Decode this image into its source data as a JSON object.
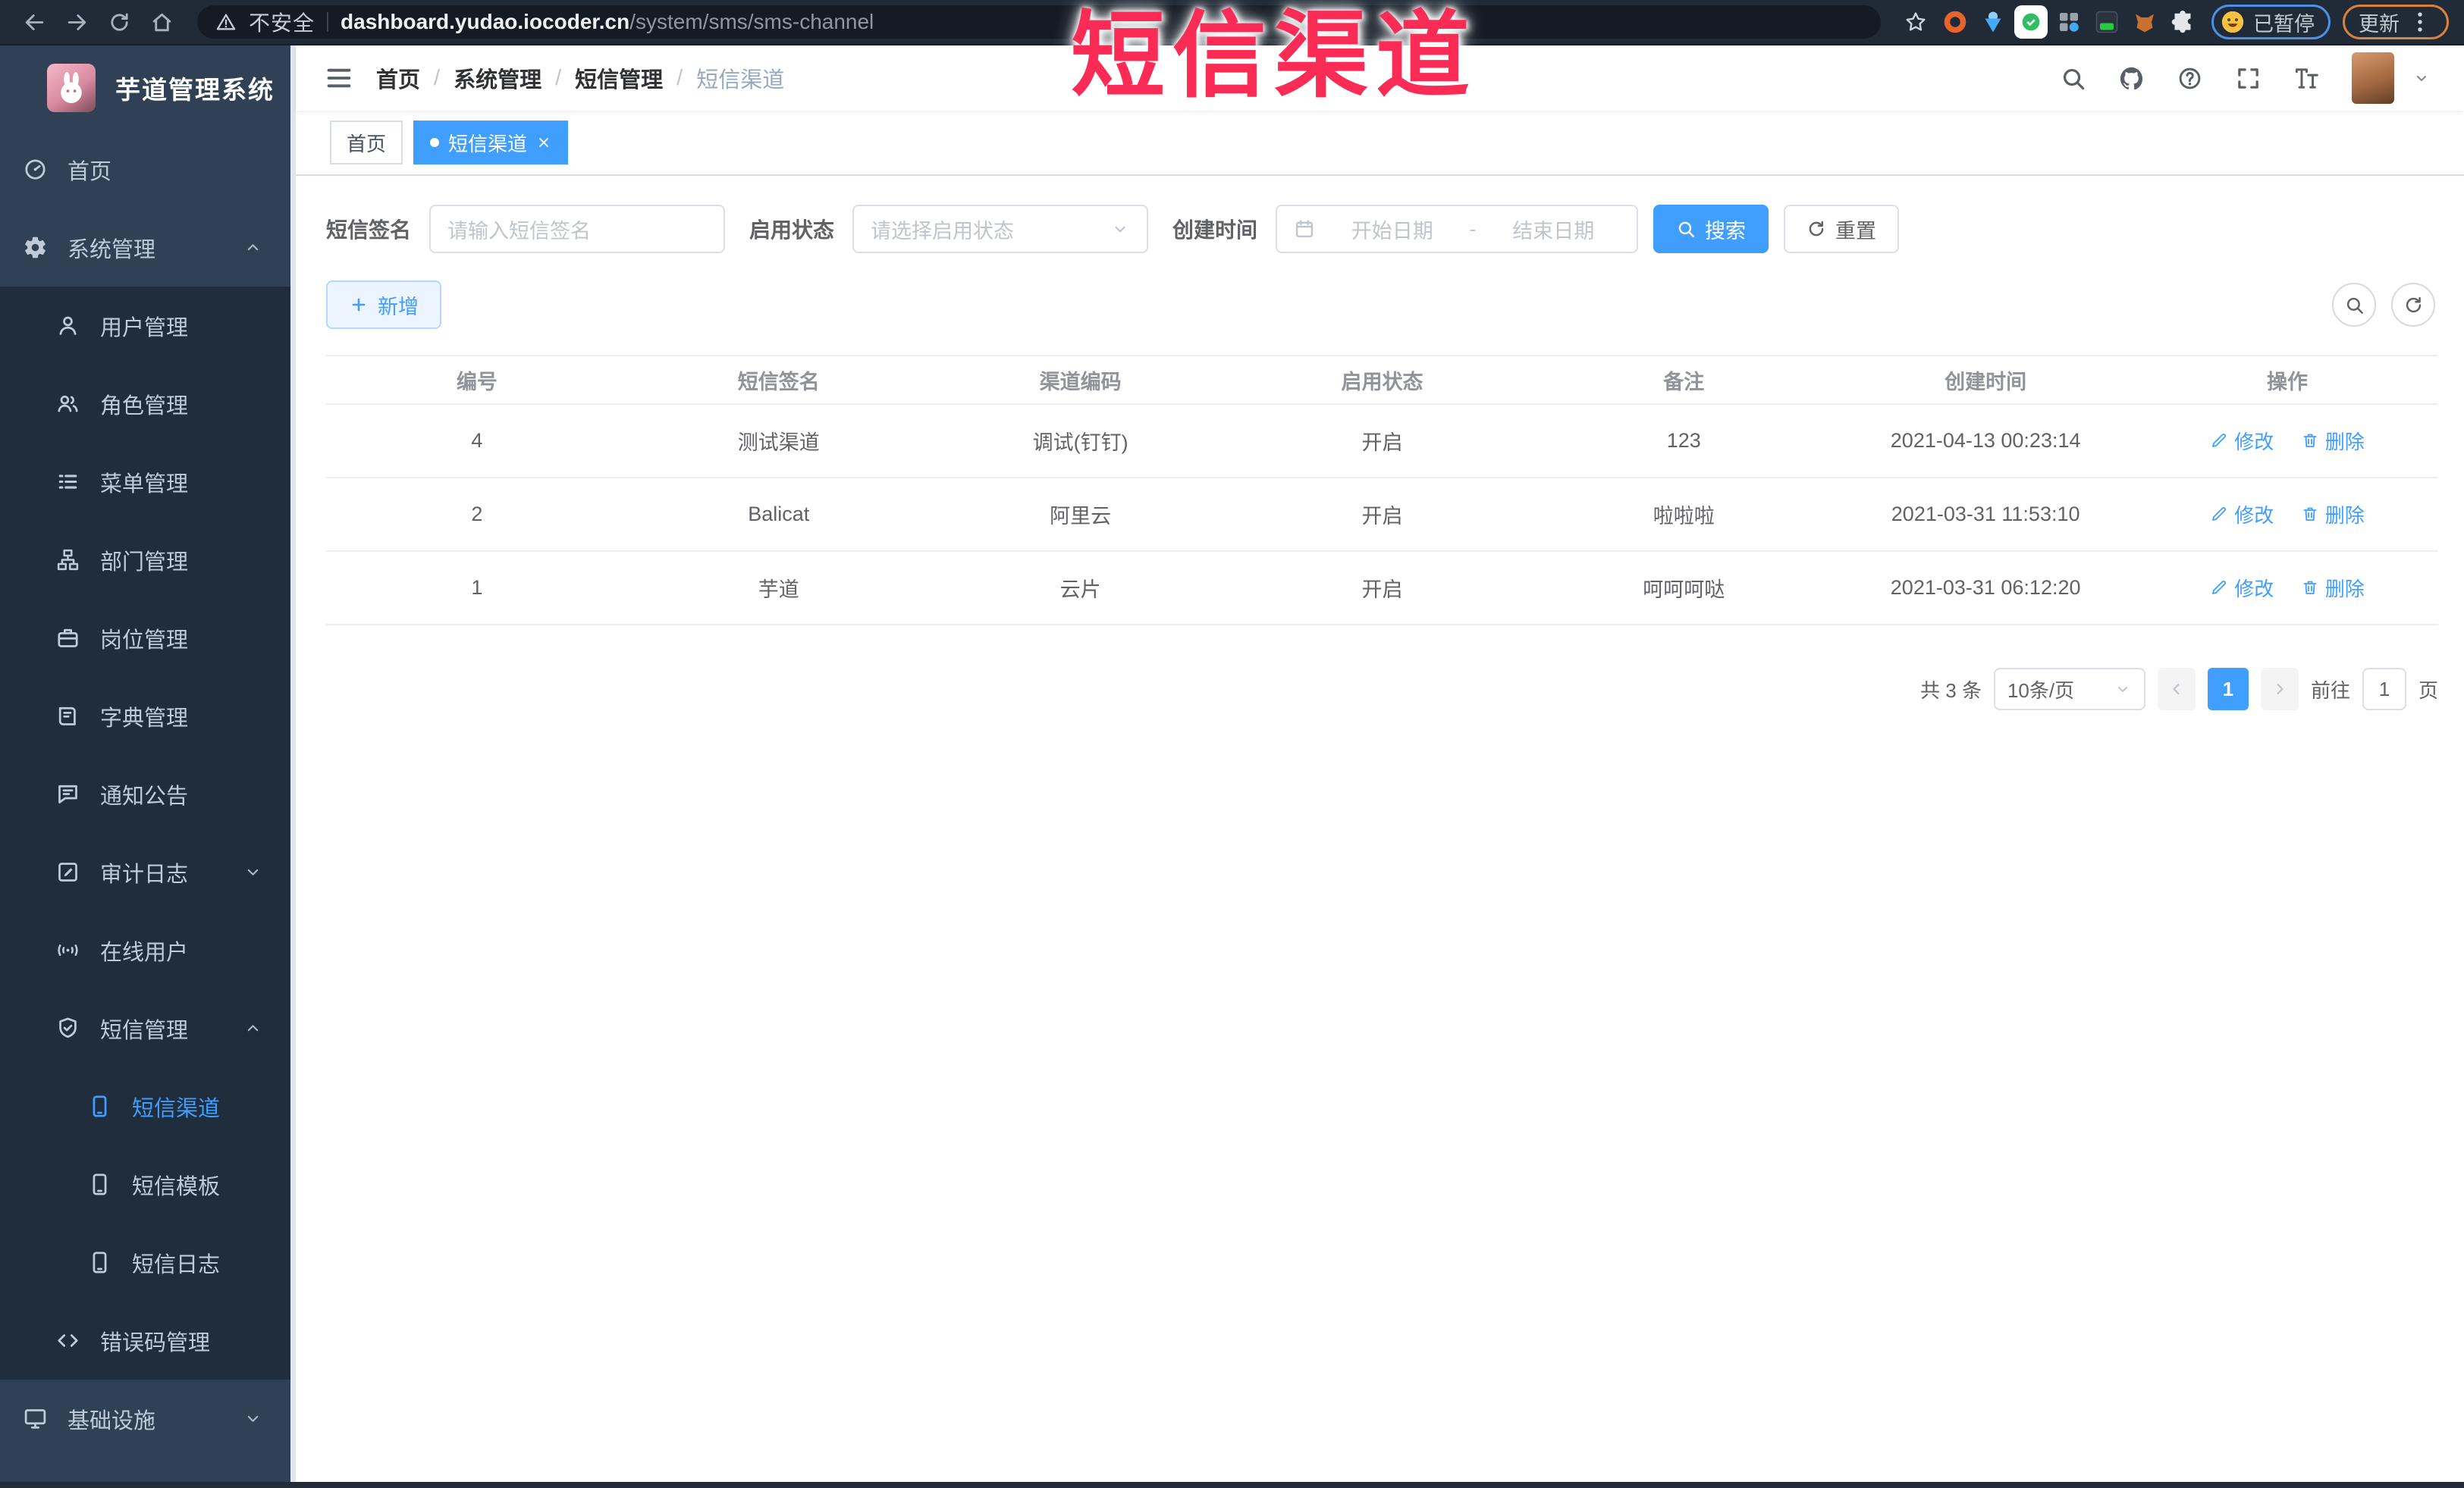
{
  "browser": {
    "security_label": "不安全",
    "url_host": "dashboard.yudao.iocoder.cn",
    "url_path": "/system/sms/sms-channel",
    "paused_label": "已暂停",
    "update_label": "更新"
  },
  "overlay": {
    "title": "短信渠道"
  },
  "sidebar": {
    "app_title": "芋道管理系统",
    "items": [
      {
        "id": "home",
        "label": "首页",
        "icon": "dashboard-icon",
        "level": 1
      },
      {
        "id": "system",
        "label": "系统管理",
        "icon": "gear-icon",
        "level": 1,
        "arrow": "up"
      },
      {
        "id": "user-mgmt",
        "label": "用户管理",
        "icon": "user-icon",
        "level": 2
      },
      {
        "id": "role-mgmt",
        "label": "角色管理",
        "icon": "users-icon",
        "level": 2
      },
      {
        "id": "menu-mgmt",
        "label": "菜单管理",
        "icon": "menu-list-icon",
        "level": 2
      },
      {
        "id": "dept-mgmt",
        "label": "部门管理",
        "icon": "org-tree-icon",
        "level": 2
      },
      {
        "id": "post-mgmt",
        "label": "岗位管理",
        "icon": "briefcase-icon",
        "level": 2
      },
      {
        "id": "dict-mgmt",
        "label": "字典管理",
        "icon": "book-icon",
        "level": 2
      },
      {
        "id": "notice",
        "label": "通知公告",
        "icon": "announcement-icon",
        "level": 2
      },
      {
        "id": "audit-log",
        "label": "审计日志",
        "icon": "audit-log-icon",
        "level": 2,
        "arrow": "down"
      },
      {
        "id": "online-users",
        "label": "在线用户",
        "icon": "online-icon",
        "level": 2
      },
      {
        "id": "sms-mgmt",
        "label": "短信管理",
        "icon": "sms-shield-icon",
        "level": 2,
        "arrow": "up"
      },
      {
        "id": "sms-channel",
        "label": "短信渠道",
        "icon": "phone-icon",
        "level": 3,
        "active": true
      },
      {
        "id": "sms-template",
        "label": "短信模板",
        "icon": "phone-icon",
        "level": 3
      },
      {
        "id": "sms-log",
        "label": "短信日志",
        "icon": "phone-icon",
        "level": 3
      },
      {
        "id": "error-code",
        "label": "错误码管理",
        "icon": "code-icon",
        "level": 2
      },
      {
        "id": "infrastructure",
        "label": "基础设施",
        "icon": "monitor-icon",
        "level": 1,
        "arrow": "down"
      }
    ]
  },
  "header": {
    "breadcrumb": [
      "首页",
      "系统管理",
      "短信管理",
      "短信渠道"
    ]
  },
  "tabs": [
    {
      "label": "首页",
      "active": false
    },
    {
      "label": "短信渠道",
      "active": true
    }
  ],
  "filters": {
    "sign_label": "短信签名",
    "sign_placeholder": "请输入短信签名",
    "status_label": "启用状态",
    "status_placeholder": "请选择启用状态",
    "time_label": "创建时间",
    "start_placeholder": "开始日期",
    "range_separator": "-",
    "end_placeholder": "结束日期",
    "search_label": "搜索",
    "reset_label": "重置"
  },
  "toolbar": {
    "add_label": "新增"
  },
  "table": {
    "columns": [
      "编号",
      "短信签名",
      "渠道编码",
      "启用状态",
      "备注",
      "创建时间",
      "操作"
    ],
    "rows": [
      {
        "id": "4",
        "sign": "测试渠道",
        "code": "调试(钉钉)",
        "status": "开启",
        "remark": "123",
        "created": "2021-04-13 00:23:14"
      },
      {
        "id": "2",
        "sign": "Balicat",
        "code": "阿里云",
        "status": "开启",
        "remark": "啦啦啦",
        "created": "2021-03-31 11:53:10"
      },
      {
        "id": "1",
        "sign": "芋道",
        "code": "云片",
        "status": "开启",
        "remark": "呵呵呵哒",
        "created": "2021-03-31 06:12:20"
      }
    ],
    "edit_label": "修改",
    "delete_label": "删除"
  },
  "pagination": {
    "total_label": "共 3 条",
    "page_size_label": "10条/页",
    "current_page": "1",
    "goto_label": "前往",
    "goto_value": "1",
    "page_unit_label": "页"
  }
}
